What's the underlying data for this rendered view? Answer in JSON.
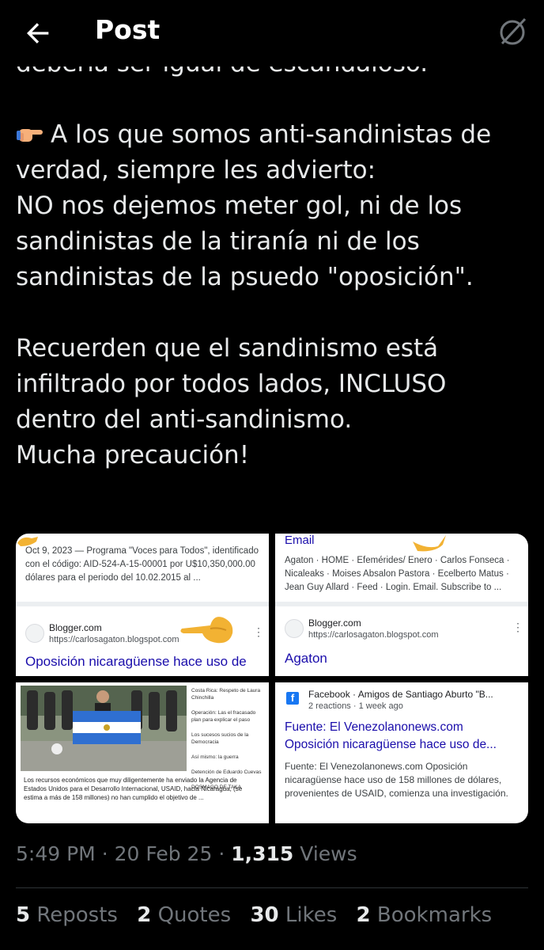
{
  "header": {
    "title": "Post"
  },
  "post": {
    "lines": [
      "debería ser igual de escandaloso.",
      "A los que somos anti-sandinistas de",
      "verdad, siempre les advierto:",
      "NO nos dejemos meter gol, ni de los",
      "sandinistas de la tiranía ni de los",
      "sandinistas de la psuedo \"oposición\".",
      "Recuerden que el sandinismo está",
      "infiltrado por todos lados, INCLUSO",
      "dentro del anti-sandinismo.",
      "Mucha precaución!"
    ],
    "emoji": "point-right-emoji"
  },
  "media": {
    "tile1": {
      "snippet": "Oct 9, 2023 — Programa \"Voces para Todos\", identificado con el código: AID-524-A-15-00001 por U$10,350,000.00 dólares para el periodo del 10.02.2015 al ...",
      "source_name": "Blogger.com",
      "source_url": "https://carlosagaton.blogspot.com",
      "result_title": "Oposición nicaragüense hace uso de"
    },
    "tile2": {
      "header": "Email",
      "snippet": "Agaton · HOME · Efemérides/ Enero · Carlos Fonseca · Nicaleaks · Moises Absalon Pastora · Ecelberto Matus · Jean Guy Allard · Feed · Login. Email. Subscribe to ...",
      "source_name": "Blogger.com",
      "source_url": "https://carlosagaton.blogspot.com",
      "result_title": "Agaton"
    },
    "tile3": {
      "caption": "Los recursos económicos que muy diligentemente ha enviado la Agencia de Estados Unidos para el Desarrollo Internacional, USAID, hacia Nicaragua, (se estima a más de 158 millones) no han cumplido el objetivo de ...",
      "side_items": [
        "Costa Rica: Respeto de Laura Chinchilla",
        "Operación: Las el fracasado plan para explicar el paso",
        "Los sucesos sucios de la Democracia",
        "Así mismo: la guerra",
        "Detención de Eduardo Cuevas",
        "DOSMAGO DE TAKA"
      ]
    },
    "tile4": {
      "fb_line": "Facebook · Amigos de Santiago Aburto \"B...",
      "reactions": "2 reactions · 1 week ago",
      "title_line1": "Fuente: El Venezolanonews.com",
      "title_line2": "Oposición nicaragüense hace uso de...",
      "snippet": "Fuente: El Venezolanonews.com Oposición nicaragüense hace uso de 158 millones de dólares, provenientes de USAID, comienza una investigación."
    }
  },
  "meta": {
    "time": "5:49 PM",
    "date": "20 Feb 25",
    "views_count": "1,315",
    "views_label": "Views",
    "separator": "·"
  },
  "stats": {
    "reposts_count": "5",
    "reposts_label": "Reposts",
    "quotes_count": "2",
    "quotes_label": "Quotes",
    "likes_count": "30",
    "likes_label": "Likes",
    "bookmarks_count": "2",
    "bookmarks_label": "Bookmarks"
  },
  "colors": {
    "background": "#000000",
    "text": "#e7e9ea",
    "muted": "#71767b",
    "link": "#1a0dab"
  }
}
